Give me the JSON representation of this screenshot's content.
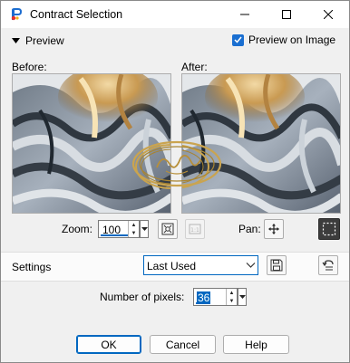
{
  "window": {
    "title": "Contract Selection"
  },
  "preview": {
    "toggle_label": "Preview",
    "preview_on_image_label": "Preview on Image",
    "preview_on_image_checked": true
  },
  "panes": {
    "before_label": "Before:",
    "after_label": "After:"
  },
  "zoom": {
    "label": "Zoom:",
    "value": "100"
  },
  "pan": {
    "label": "Pan:"
  },
  "settings": {
    "label": "Settings",
    "preset_value": "Last Used"
  },
  "number_of_pixels": {
    "label": "Number of pixels:",
    "value": "36"
  },
  "buttons": {
    "ok": "OK",
    "cancel": "Cancel",
    "help": "Help"
  },
  "colors": {
    "accent": "#0067c0",
    "checkbox": "#1a6fd1",
    "background": "#f0f0f0"
  }
}
